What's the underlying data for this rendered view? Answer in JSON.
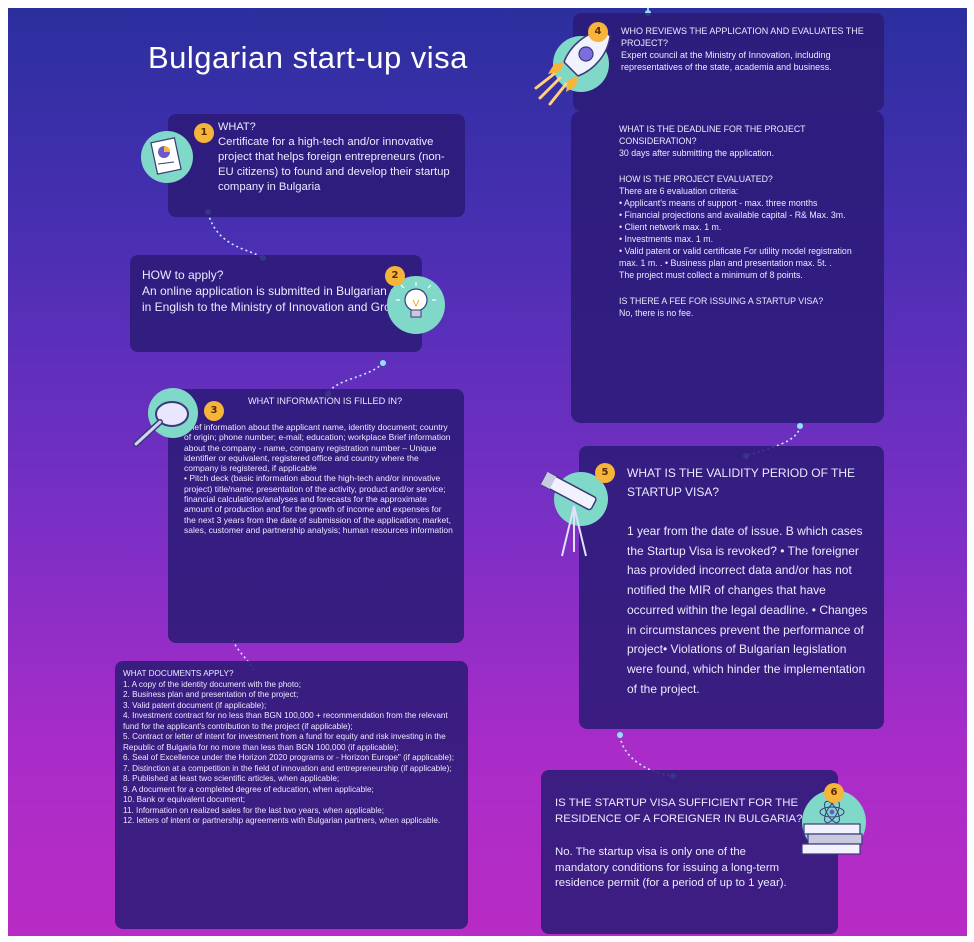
{
  "title": "Bulgarian start-up visa",
  "accent_colors": {
    "badge": "#f6b43a",
    "icon_bg": "#7fd8c8",
    "box": "#2c1b78"
  },
  "sections": {
    "what": {
      "number": "1",
      "heading": "WHAT?",
      "body": "Certificate for a high-tech and/or innovative project that helps foreign entrepreneurs (non-EU citizens) to found and develop their startup company in Bulgaria"
    },
    "how": {
      "number": "2",
      "heading": "HOW to apply?",
      "body": "An online application is submitted in Bulgarian or in English to the Ministry of Innovation and Growth"
    },
    "info": {
      "number": "3",
      "heading": "WHAT INFORMATION IS FILLED IN?",
      "body1": "Brief information about the applicant name, identity document; country of origin; phone number; e-mail; education; workplace Brief information about the company - name, company registration number – Unique identifier or equivalent, registered office and country where the company is registered, if applicable",
      "body2": "• Pitch deck (basic information about the high-tech and/or innovative project) title/name; presentation of the activity, product and/or service; financial calculations/analyses and forecasts for the approximate amount of production and for the growth of income and expenses for the next 3 years from the date of submission of the application; market, sales, customer and partnership analysis; human resources information"
    },
    "docs": {
      "heading": "WHAT DOCUMENTS APPLY?",
      "items": [
        "1. A copy of the identity document with the photo;",
        "2. Business plan and presentation of the project;",
        "3. Valid patent document (if applicable);",
        "4. Investment contract for no less than BGN 100,000 + recommendation from the relevant fund for the applicant's contribution to the project (if applicable);",
        "5. Contract or letter of intent for investment from a fund for equity and risk investing in the Republic of Bulgaria for no more than less than BGN 100,000 (if applicable);",
        "6. Seal of Excellence under the Horizon 2020 programs or - Horizon Europe\" (if applicable);",
        "7. Distinction at a competition in the field of innovation and entrepreneurship (if applicable);",
        "8. Published at least two scientific articles, when applicable;",
        "9. A document for a completed degree of education, when applicable;",
        "10. Bank or equivalent document;",
        "11. Information on realized sales for the last two years, when applicable;",
        "12. letters of intent or partnership agreements with Bulgarian partners, when applicable."
      ]
    },
    "review": {
      "number": "4",
      "heading": "WHO REVIEWS THE APPLICATION AND EVALUATES THE PROJECT?",
      "body": "Expert council at the Ministry of Innovation, including representatives of the state, academia and business."
    },
    "deadline": {
      "q1": "WHAT IS THE DEADLINE FOR THE PROJECT CONSIDERATION?",
      "a1": "30 days after submitting the application.",
      "q2": "HOW IS THE PROJECT EVALUATED?",
      "a2_intro": "There are 6 evaluation criteria:",
      "criteria": [
        "• Applicant's means of support - max. three months",
        "• Financial projections and available capital - R& Max. 3m.",
        "• Client network max. 1 m.",
        "• Investments max. 1 m.",
        "• Valid patent or valid certificate For utility model registration max. 1 m. . • Business plan and presentation max. 5t. ."
      ],
      "a2_outro": "The project must collect a minimum of 8 points.",
      "q3": "IS THERE A FEE FOR ISSUING A STARTUP VISA?",
      "a3": "No, there is no fee."
    },
    "validity": {
      "number": "5",
      "heading": "WHAT IS THE VALIDITY PERIOD OF THE STARTUP VISA?",
      "body": "1 year from the date of issue. B which cases the Startup Visa is revoked? • The foreigner has provided incorrect data and/or has not notified the MIR of changes that have occurred within the legal deadline. • Changes in circumstances prevent the performance of project• Violations of Bulgarian legislation were found, which hinder the implementation of the project."
    },
    "residence": {
      "number": "6",
      "heading": "IS THE STARTUP VISA SUFFICIENT FOR THE RESIDENCE OF A FOREIGNER IN BULGARIA?",
      "body": "No. The startup visa is only one of the mandatory conditions for issuing a long-term residence permit (for a period of up to 1 year)."
    }
  }
}
